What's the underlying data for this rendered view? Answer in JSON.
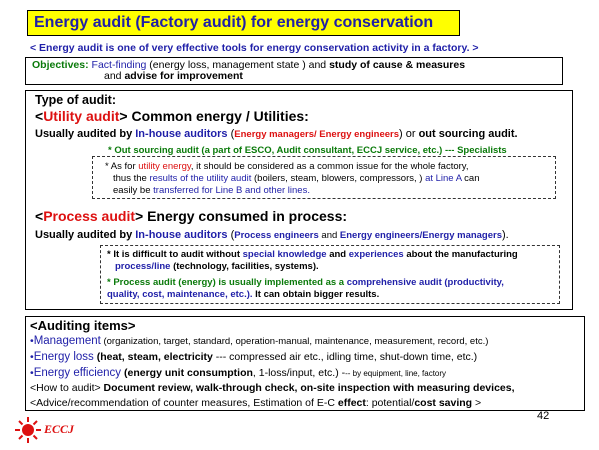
{
  "title": "Energy audit (Factory audit) for energy conservation",
  "subtitle": "< Energy audit is one of very effective tools for energy conservation activity in a factory. >",
  "objectives": {
    "label": "Objectives:",
    "l1_a": "Fact-finding",
    "l1_b": " (energy loss, management state ) and ",
    "l1_c": "study of cause & measures",
    "l2_a": "and ",
    "l2_b": "advise for improvement"
  },
  "type": {
    "heading": "Type of audit:",
    "utility": {
      "open": "<",
      "name": "Utility audit",
      "rest": "> Common energy / Utilities:",
      "aud_a": "Usually audited by ",
      "aud_b": "In-house auditors",
      "aud_c": " (",
      "aud_d": "Energy managers/ Energy engineers",
      "aud_e": ") or ",
      "aud_f": "out sourcing audit.",
      "outsrc": "* Out sourcing audit  (a part of ESCO, Audit consultant, ECCJ service, etc.) --- Specialists",
      "note_l1_a": "* As for ",
      "note_l1_b": "utility energy",
      "note_l1_c": ", it should be considered as a common issue for the whole  factory,",
      "note_l2_a": "thus the ",
      "note_l2_b": "results of the utility audit",
      "note_l2_c": " (boilers, steam, blowers, compressors, ) ",
      "note_l2_d": "at Line A",
      "note_l2_e": " can",
      "note_l3_a": "easily be ",
      "note_l3_b": "transferred for Line B and other lines."
    },
    "process": {
      "open": "<",
      "name": "Process audit",
      "rest": "> Energy consumed in process:",
      "aud_a": "Usually audited by ",
      "aud_b": "In-house auditors",
      "aud_c": " (",
      "aud_d": "Process engineers",
      "aud_e": " and ",
      "aud_f": "Energy engineers/Energy managers",
      "aud_g": ").",
      "n1_l1_a": "*  It is difficult to audit without ",
      "n1_l1_b": "special knowledge",
      "n1_l1_c": " and ",
      "n1_l1_d": "experiences",
      "n1_l1_e": " about the manufacturing",
      "n1_l2_a": "process/line",
      "n1_l2_b": " (technology, facilities, systems).",
      "n2_l1_a": "* Process audit (energy) is usually implemented as a ",
      "n2_l1_b": "comprehensive audit (productivity,",
      "n2_l2_a": "quality, cost,   maintenance, etc.).",
      "n2_l2_b": "  It can obtain ",
      "n2_l2_c": "bigger results."
    }
  },
  "auditing": {
    "heading": "<Auditing items>",
    "r1_a": "Management",
    "r1_b": " (organization, target, standard, operation-manual, maintenance, measurement, record, etc.)",
    "r2_a": "Energy loss",
    "r2_b": " (heat, steam, electricity",
    "r2_c": " --- compressed air etc., idling time, shut-down time, etc.)",
    "r3_a": "Energy efficiency",
    "r3_b": " (energy unit consumption",
    "r3_c": ", 1-loss/input, etc.)  -",
    "r3_d": "--  by equipment, line, factory",
    "r4_a": "<How to audit>   ",
    "r4_b": "Document review, walk-through check, on-site inspection with measuring devices,",
    "r5_a": "<Advice/recommendation",
    "r5_b": " of counter measures,  Estimation of E-C ",
    "r5_c": "effect",
    "r5_d": ": potential/",
    "r5_e": "cost saving",
    "r5_f": " >"
  },
  "bullet": "•",
  "logo_text": "ECCJ",
  "page_number": "42",
  "colors": {
    "title_bg": "#ffff00",
    "blue": "#1f1fa8",
    "red": "#dd1111",
    "green": "#0a7a0a"
  }
}
